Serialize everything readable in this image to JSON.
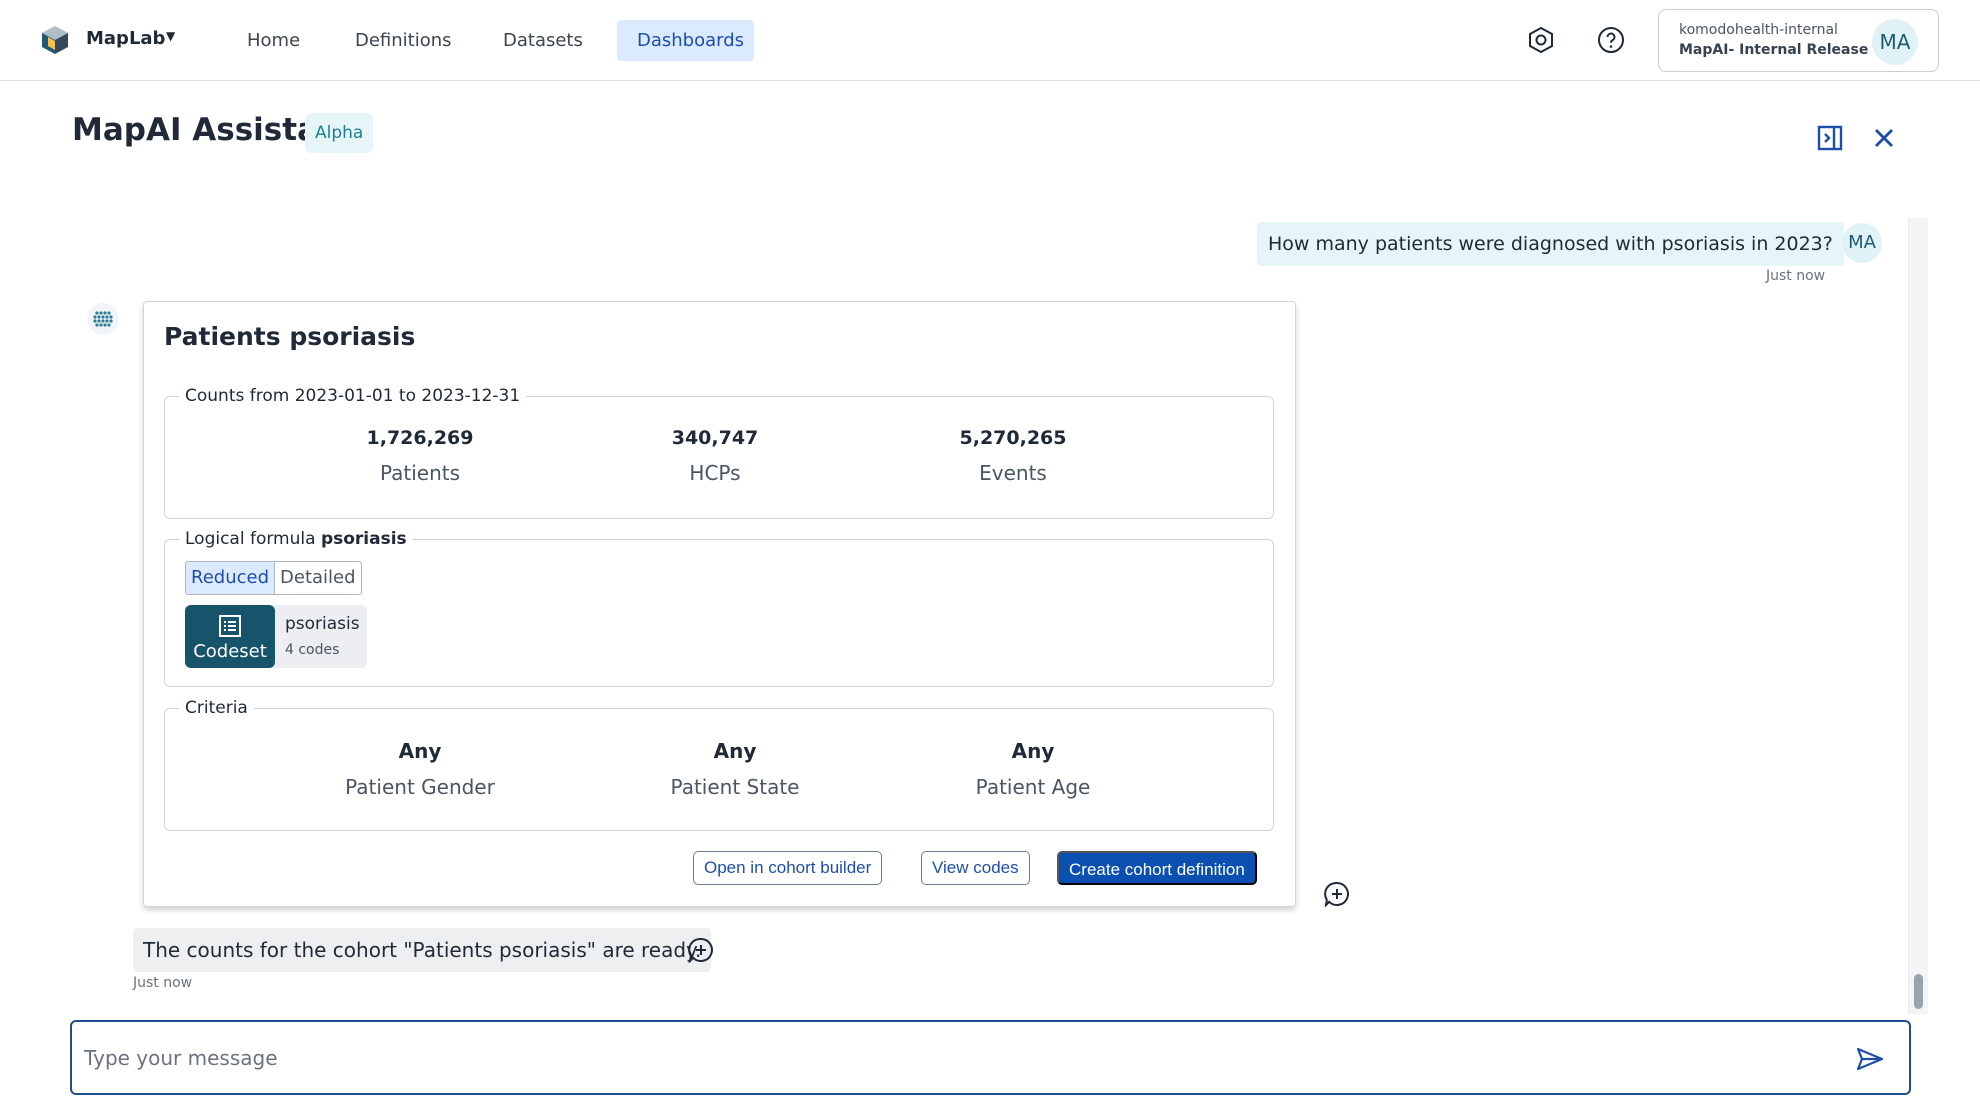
{
  "nav": {
    "app_name": "MapLab",
    "items": [
      {
        "label": "Home"
      },
      {
        "label": "Definitions"
      },
      {
        "label": "Datasets"
      },
      {
        "label": "Dashboards",
        "active": true
      }
    ],
    "account": {
      "org": "komodohealth-internal",
      "name": "MapAI- Internal Release",
      "initials": "MA"
    }
  },
  "assistant": {
    "title": "MapAI Assistant",
    "badge": "Alpha"
  },
  "chat": {
    "user_message": "How many patients were diagnosed with psoriasis in 2023?",
    "user_initials": "MA",
    "user_timestamp": "Just now",
    "card": {
      "title": "Patients psoriasis",
      "counts_legend": "Counts from 2023-01-01 to 2023-12-31",
      "counts": [
        {
          "value": "1,726,269",
          "label": "Patients"
        },
        {
          "value": "340,747",
          "label": "HCPs"
        },
        {
          "value": "5,270,265",
          "label": "Events"
        }
      ],
      "formula_legend_prefix": "Logical formula",
      "formula_legend_name": "psoriasis",
      "toggle": {
        "reduced": "Reduced",
        "detailed": "Detailed",
        "selected": "Reduced"
      },
      "codeset": {
        "type_label": "Codeset",
        "name": "psoriasis",
        "codes": "4 codes"
      },
      "criteria_legend": "Criteria",
      "criteria": [
        {
          "value": "Any",
          "label": "Patient Gender"
        },
        {
          "value": "Any",
          "label": "Patient State"
        },
        {
          "value": "Any",
          "label": "Patient Age"
        }
      ],
      "buttons": {
        "open_builder": "Open in cohort builder",
        "view_codes": "View codes",
        "create_definition": "Create cohort definition"
      }
    },
    "bot_message": "The counts for the cohort \"Patients psoriasis\" are ready.",
    "bot_timestamp": "Just now"
  },
  "composer": {
    "placeholder": "Type your message",
    "value": ""
  },
  "icons": {
    "logo": "maplab-cube-logo",
    "settings": "settings-hexagon-icon",
    "help": "help-circle-icon",
    "panel": "dock-panel-icon",
    "close": "close-icon",
    "bot": "dotted-grid-bot-icon",
    "feedback": "add-comment-icon",
    "send": "send-icon"
  },
  "colors": {
    "accent": "#0b4fb0",
    "active_tab_bg": "#dbeafe",
    "codeset_bg": "#17536b",
    "badge_bg": "#e6f6f8"
  }
}
